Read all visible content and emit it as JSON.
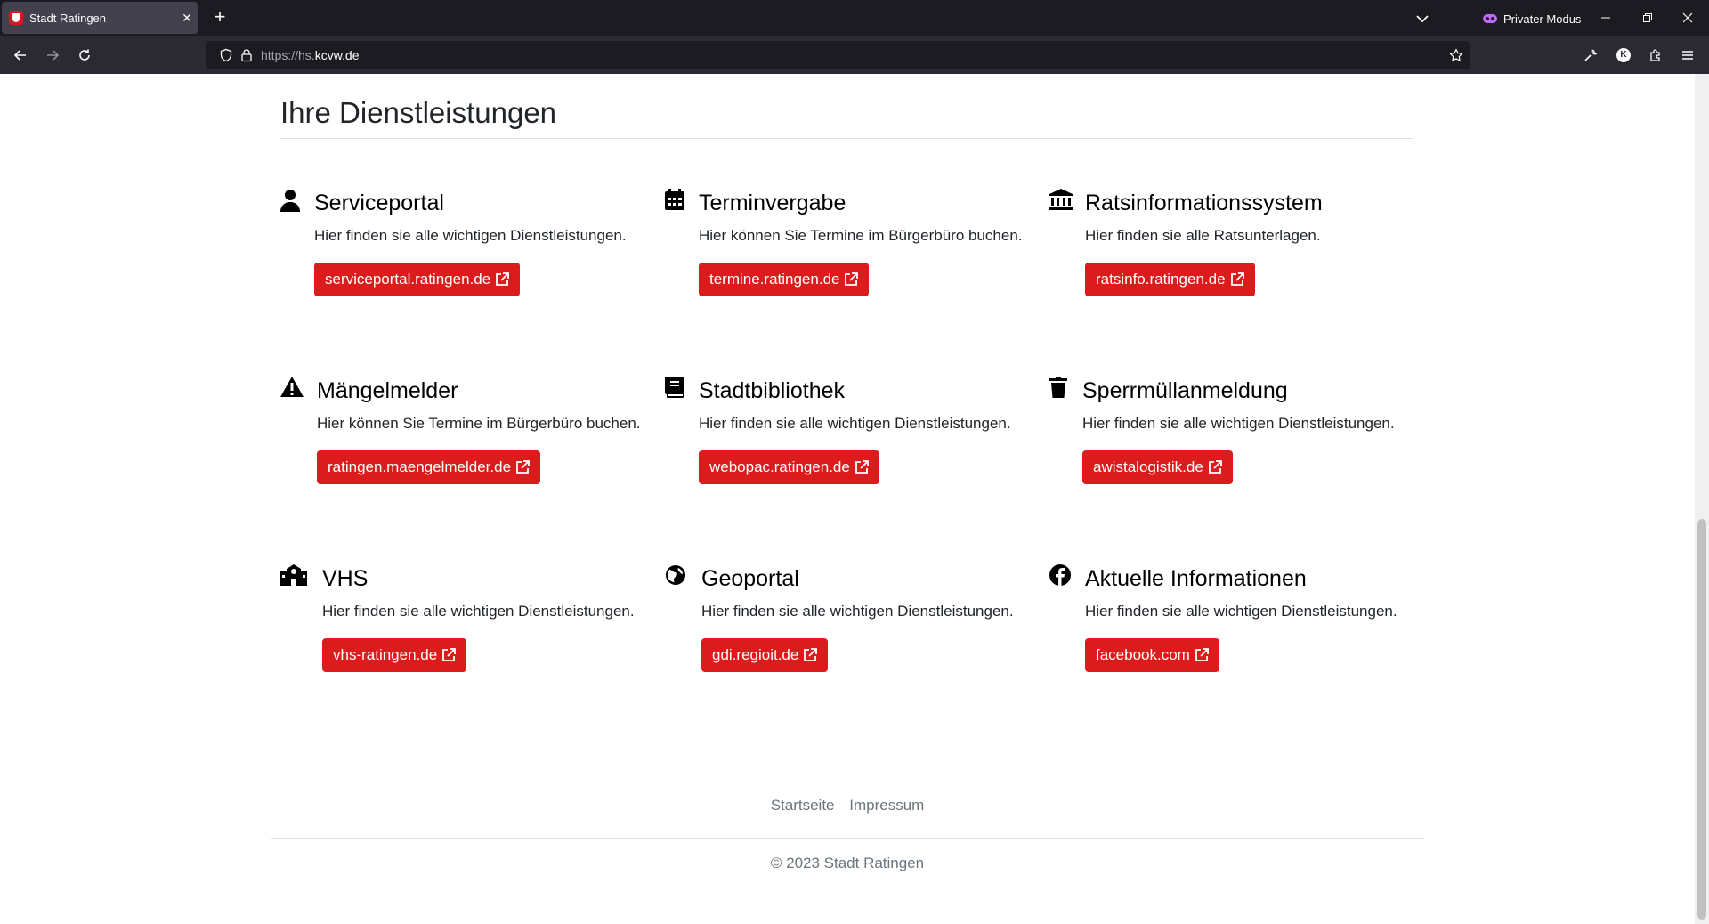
{
  "browser": {
    "tab_title": "Stadt Ratingen",
    "tab_close": "✕",
    "new_tab": "+",
    "private_label": "Privater Modus",
    "account_initial": "K",
    "url_prefix": "https://hs.",
    "url_domain": "kcvw.de"
  },
  "page": {
    "heading": "Ihre Dienstleistungen"
  },
  "services": [
    {
      "title": "Serviceportal",
      "desc": "Hier finden sie alle wichtigen Dienstleistungen.",
      "link": "serviceportal.ratingen.de",
      "icon": "user-icon"
    },
    {
      "title": "Terminvergabe",
      "desc": "Hier können Sie Termine im Bürgerbüro buchen.",
      "link": "termine.ratingen.de",
      "icon": "calendar-icon"
    },
    {
      "title": "Ratsinformationssystem",
      "desc": "Hier finden sie alle Ratsunterlagen.",
      "link": "ratsinfo.ratingen.de",
      "icon": "building-columns-icon"
    },
    {
      "title": "Mängelmelder",
      "desc": "Hier können Sie Termine im Bürgerbüro buchen.",
      "link": "ratingen.maengelmelder.de",
      "icon": "warning-icon"
    },
    {
      "title": "Stadtbibliothek",
      "desc": "Hier finden sie alle wichtigen Dienstleistungen.",
      "link": "webopac.ratingen.de",
      "icon": "book-icon"
    },
    {
      "title": "Sperrmüllanmeldung",
      "desc": "Hier finden sie alle wichtigen Dienstleistungen.",
      "link": "awistalogistik.de",
      "icon": "trash-icon"
    },
    {
      "title": "VHS",
      "desc": "Hier finden sie alle wichtigen Dienstleistungen.",
      "link": "vhs-ratingen.de",
      "icon": "school-icon"
    },
    {
      "title": "Geoportal",
      "desc": "Hier finden sie alle wichtigen Dienstleistungen.",
      "link": "gdi.regioit.de",
      "icon": "globe-icon"
    },
    {
      "title": "Aktuelle Informationen",
      "desc": "Hier finden sie alle wichtigen Dienstleistungen.",
      "link": "facebook.com",
      "icon": "facebook-icon"
    }
  ],
  "footer": {
    "links": [
      "Startseite",
      "Impressum"
    ],
    "copyright": "© 2023 Stadt Ratingen"
  },
  "colors": {
    "accent": "#dc1c1c",
    "chrome_dark": "#1c1b22",
    "chrome_toolbar": "#2b2a33"
  }
}
